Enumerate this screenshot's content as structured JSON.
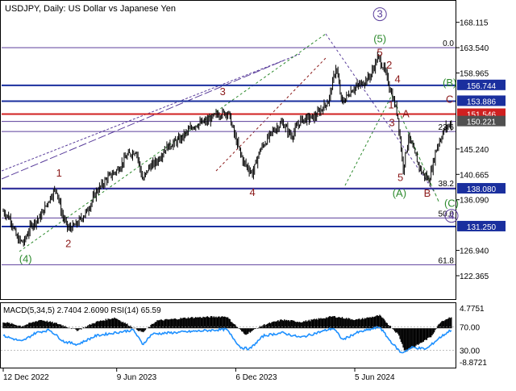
{
  "header": {
    "title": "USDJPY, Daily:  US Dollar vs Japanese Yen"
  },
  "chart_data": [
    {
      "type": "line",
      "panel": "price",
      "title": "USDJPY, Daily:  US Dollar vs Japanese Yen",
      "x_tick_labels": [
        "12 Dec 2022",
        "9 Jun 2023",
        "6 Dec 2023",
        "5 Jun 2024"
      ],
      "x_tick_day_index": [
        0,
        122,
        250,
        378
      ],
      "y_ticks": [
        168.115,
        163.54,
        158.965,
        145.24,
        140.665,
        136.09,
        126.94,
        122.365
      ],
      "ylim": [
        118.0,
        172.0
      ],
      "xlim_days": [
        0,
        477
      ],
      "price_path": [
        {
          "day": 0,
          "price": 134.0
        },
        {
          "day": 8,
          "price": 132.5
        },
        {
          "day": 15,
          "price": 129.0
        },
        {
          "day": 22,
          "price": 128.3
        },
        {
          "day": 30,
          "price": 131.5
        },
        {
          "day": 40,
          "price": 133.0
        },
        {
          "day": 50,
          "price": 136.4
        },
        {
          "day": 57,
          "price": 138.2
        },
        {
          "day": 63,
          "price": 133.5
        },
        {
          "day": 70,
          "price": 130.8
        },
        {
          "day": 78,
          "price": 131.5
        },
        {
          "day": 90,
          "price": 134.0
        },
        {
          "day": 100,
          "price": 137.5
        },
        {
          "day": 112,
          "price": 140.0
        },
        {
          "day": 123,
          "price": 141.5
        },
        {
          "day": 133,
          "price": 144.0
        },
        {
          "day": 143,
          "price": 145.0
        },
        {
          "day": 150,
          "price": 139.5
        },
        {
          "day": 156,
          "price": 141.8
        },
        {
          "day": 165,
          "price": 143.0
        },
        {
          "day": 175,
          "price": 145.5
        },
        {
          "day": 190,
          "price": 147.0
        },
        {
          "day": 205,
          "price": 149.5
        },
        {
          "day": 220,
          "price": 150.3
        },
        {
          "day": 230,
          "price": 151.5
        },
        {
          "day": 242,
          "price": 151.9
        },
        {
          "day": 250,
          "price": 147.0
        },
        {
          "day": 258,
          "price": 143.0
        },
        {
          "day": 268,
          "price": 140.8
        },
        {
          "day": 276,
          "price": 145.0
        },
        {
          "day": 290,
          "price": 148.5
        },
        {
          "day": 300,
          "price": 150.0
        },
        {
          "day": 310,
          "price": 147.5
        },
        {
          "day": 320,
          "price": 150.5
        },
        {
          "day": 335,
          "price": 151.0
        },
        {
          "day": 350,
          "price": 154.0
        },
        {
          "day": 358,
          "price": 160.2
        },
        {
          "day": 364,
          "price": 153.5
        },
        {
          "day": 375,
          "price": 156.0
        },
        {
          "day": 385,
          "price": 157.0
        },
        {
          "day": 395,
          "price": 158.5
        },
        {
          "day": 403,
          "price": 161.9
        },
        {
          "day": 410,
          "price": 159.5
        },
        {
          "day": 418,
          "price": 155.0
        },
        {
          "day": 424,
          "price": 151.5
        },
        {
          "day": 430,
          "price": 141.7
        },
        {
          "day": 436,
          "price": 147.5
        },
        {
          "day": 442,
          "price": 144.5
        },
        {
          "day": 450,
          "price": 141.0
        },
        {
          "day": 458,
          "price": 139.6
        },
        {
          "day": 466,
          "price": 145.5
        },
        {
          "day": 475,
          "price": 149.0
        },
        {
          "day": 482,
          "price": 149.9
        }
      ],
      "horizontal_levels": [
        {
          "price": 163.54,
          "color": "#5b3f9c",
          "label": "0.0"
        },
        {
          "price": 156.744,
          "color": "#1a2f9e",
          "price_label": "156.744",
          "label_color": "#1a2f9e"
        },
        {
          "price": 153.886,
          "color": "#1a2f9e",
          "price_label": "153.886",
          "label_color": "#1a2f9e"
        },
        {
          "price": 151.546,
          "color": "#d02020",
          "price_label": "151.546",
          "label_color": "#d02020"
        },
        {
          "price": 150.221,
          "color": "#5b3f9c",
          "price_label": "150.221",
          "label_color": "#505050"
        },
        {
          "price": 148.4,
          "color": "#5b3f9c",
          "label": "23.6"
        },
        {
          "price": 138.08,
          "color": "#1a2f9e",
          "price_label": "138.080",
          "label_color": "#1a2f9e"
        },
        {
          "price": 138.2,
          "color": "#5b3f9c",
          "label": "38.2"
        },
        {
          "price": 131.25,
          "color": "#1a2f9e",
          "price_label": "131.250",
          "label_color": "#1a2f9e"
        },
        {
          "price": 132.8,
          "color": "#5b3f9c",
          "label": "50.0"
        },
        {
          "price": 124.35,
          "color": "#5b3f9c",
          "label": "61.8"
        }
      ],
      "wave_labels": [
        {
          "day": 24,
          "price": 124.8,
          "text": "(4)",
          "color": "#2d8a2d"
        },
        {
          "day": 60,
          "price": 140.3,
          "text": "1",
          "color": "#8b1a1a"
        },
        {
          "day": 70,
          "price": 127.5,
          "text": "2",
          "color": "#8b1a1a"
        },
        {
          "day": 236,
          "price": 155.0,
          "text": "3",
          "color": "#8b1a1a"
        },
        {
          "day": 268,
          "price": 136.8,
          "text": "4",
          "color": "#8b1a1a"
        },
        {
          "day": 405,
          "price": 169.0,
          "text": "3",
          "color": "#5b3f9c",
          "circled": true
        },
        {
          "day": 405,
          "price": 164.5,
          "text": "(5)",
          "color": "#2d8a2d"
        },
        {
          "day": 405,
          "price": 162.0,
          "text": "5",
          "color": "#8b1a1a"
        },
        {
          "day": 415,
          "price": 159.8,
          "text": "2",
          "color": "#8b1a1a"
        },
        {
          "day": 424,
          "price": 157.2,
          "text": "4",
          "color": "#8b1a1a"
        },
        {
          "day": 417,
          "price": 152.6,
          "text": "1",
          "color": "#8b1a1a"
        },
        {
          "day": 433,
          "price": 151.0,
          "text": "A",
          "color": "#8b1a1a"
        },
        {
          "day": 418,
          "price": 149.4,
          "text": "3",
          "color": "#8b1a1a"
        },
        {
          "day": 427,
          "price": 139.5,
          "text": "5",
          "color": "#8b1a1a"
        },
        {
          "day": 426,
          "price": 136.6,
          "text": "(A)",
          "color": "#2d8a2d"
        },
        {
          "day": 456,
          "price": 136.6,
          "text": "B",
          "color": "#8b1a1a"
        },
        {
          "day": 480,
          "price": 156.6,
          "text": "(B)",
          "color": "#2d8a2d"
        },
        {
          "day": 480,
          "price": 153.6,
          "text": "C",
          "color": "#8b1a1a"
        },
        {
          "day": 545,
          "price": 134.8,
          "text": "(C)",
          "color": "#2d8a2d"
        },
        {
          "day": 545,
          "price": 132.6,
          "text": "4",
          "color": "#5b3f9c",
          "circled": true
        }
      ]
    },
    {
      "type": "bar",
      "panel": "indicator",
      "title": "MACD(5,34,5) 2.7404 2.6090 RSI(14) 65.59",
      "y_ticks": [
        4.7751,
        70.0,
        30.0,
        -8.8721
      ],
      "y_tick_labels": [
        "4.7751",
        "70.00",
        "30.00",
        "-8.8721"
      ],
      "macd_values": [
        {
          "day": 0,
          "value": 1.5
        },
        {
          "day": 20,
          "value": 0.5
        },
        {
          "day": 40,
          "value": 2.0
        },
        {
          "day": 60,
          "value": 1.0
        },
        {
          "day": 80,
          "value": -0.5
        },
        {
          "day": 100,
          "value": 1.5
        },
        {
          "day": 120,
          "value": 2.5
        },
        {
          "day": 150,
          "value": -1.0
        },
        {
          "day": 165,
          "value": 1.8
        },
        {
          "day": 200,
          "value": 2.5
        },
        {
          "day": 240,
          "value": 2.8
        },
        {
          "day": 260,
          "value": -1.5
        },
        {
          "day": 280,
          "value": 0.8
        },
        {
          "day": 300,
          "value": 2.0
        },
        {
          "day": 320,
          "value": 1.5
        },
        {
          "day": 355,
          "value": 2.8
        },
        {
          "day": 380,
          "value": 2.0
        },
        {
          "day": 405,
          "value": 3.0
        },
        {
          "day": 425,
          "value": -1.5
        },
        {
          "day": 432,
          "value": -5.5
        },
        {
          "day": 445,
          "value": -4.0
        },
        {
          "day": 460,
          "value": -2.0
        },
        {
          "day": 470,
          "value": 1.5
        },
        {
          "day": 482,
          "value": 2.74
        }
      ],
      "rsi_values": [
        {
          "day": 0,
          "value": 55
        },
        {
          "day": 20,
          "value": 45
        },
        {
          "day": 35,
          "value": 60
        },
        {
          "day": 50,
          "value": 65
        },
        {
          "day": 65,
          "value": 45
        },
        {
          "day": 80,
          "value": 40
        },
        {
          "day": 100,
          "value": 55
        },
        {
          "day": 120,
          "value": 60
        },
        {
          "day": 140,
          "value": 65
        },
        {
          "day": 150,
          "value": 40
        },
        {
          "day": 160,
          "value": 58
        },
        {
          "day": 200,
          "value": 62
        },
        {
          "day": 240,
          "value": 66
        },
        {
          "day": 255,
          "value": 35
        },
        {
          "day": 265,
          "value": 32
        },
        {
          "day": 280,
          "value": 55
        },
        {
          "day": 300,
          "value": 60
        },
        {
          "day": 320,
          "value": 52
        },
        {
          "day": 355,
          "value": 68
        },
        {
          "day": 365,
          "value": 48
        },
        {
          "day": 380,
          "value": 60
        },
        {
          "day": 405,
          "value": 70
        },
        {
          "day": 415,
          "value": 48
        },
        {
          "day": 428,
          "value": 25
        },
        {
          "day": 440,
          "value": 35
        },
        {
          "day": 455,
          "value": 32
        },
        {
          "day": 468,
          "value": 50
        },
        {
          "day": 482,
          "value": 65.59
        }
      ]
    }
  ]
}
